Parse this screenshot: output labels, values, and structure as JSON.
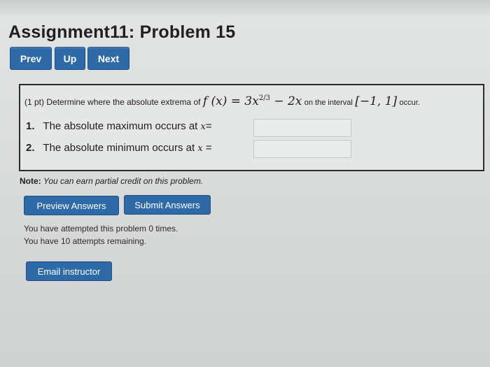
{
  "page": {
    "title": "Assignment11: Problem 15"
  },
  "nav": {
    "prev": "Prev",
    "up": "Up",
    "next": "Next"
  },
  "problem": {
    "points": "(1 pt)",
    "prompt": "Determine where the absolute extrema of",
    "function": "f (x) = 3x",
    "exponent": "2/3",
    "function_tail": " − 2x",
    "interval_label": "on the interval",
    "interval": "[−1, 1]",
    "trailing": "occur.",
    "questions": [
      {
        "number": "1.",
        "text": "The absolute maximum occurs at",
        "var": "x",
        "eq": "="
      },
      {
        "number": "2.",
        "text": "The absolute minimum occurs at",
        "var": "x",
        "eq": " ="
      }
    ]
  },
  "note": {
    "label": "Note:",
    "text": "You can earn partial credit on this problem."
  },
  "actions": {
    "preview": "Preview Answers",
    "submit": "Submit Answers"
  },
  "attempts": {
    "line1": "You have attempted this problem 0 times.",
    "line2": "You have 10 attempts remaining."
  },
  "email": {
    "label": "Email instructor"
  },
  "colors": {
    "button_blue": "#2f6aa8",
    "page_background": "#dcdfdd"
  }
}
